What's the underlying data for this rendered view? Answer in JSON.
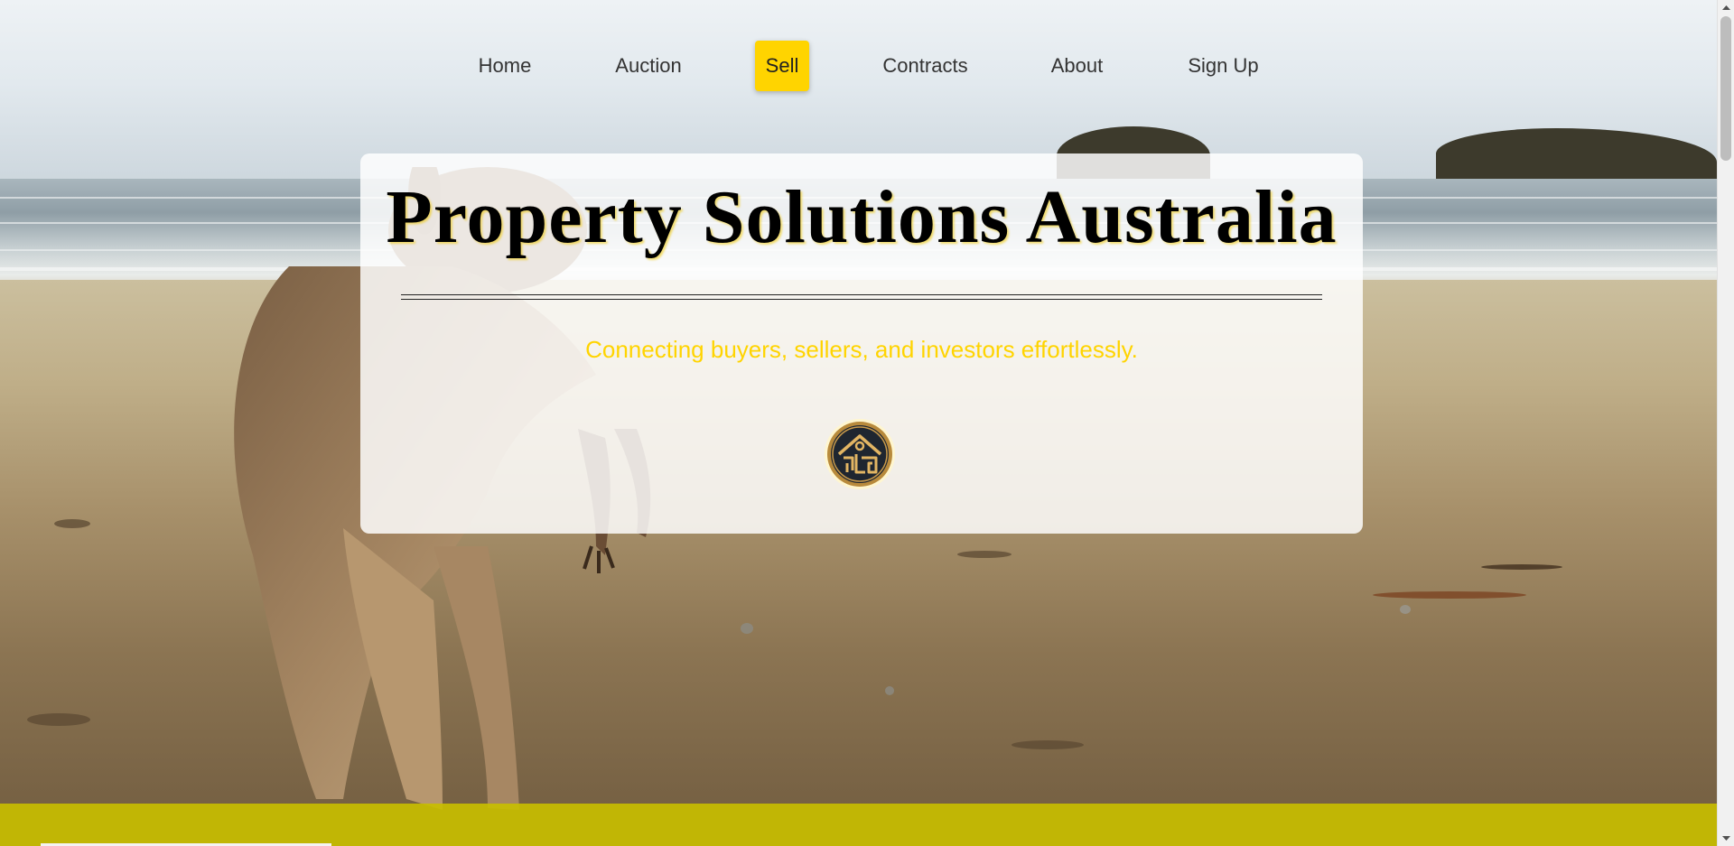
{
  "nav": {
    "items": [
      {
        "label": "Home",
        "active": false
      },
      {
        "label": "Auction",
        "active": false
      },
      {
        "label": "Sell",
        "active": true
      },
      {
        "label": "Contracts",
        "active": false
      },
      {
        "label": "About",
        "active": false
      },
      {
        "label": "Sign Up",
        "active": false
      }
    ]
  },
  "hero": {
    "title": "Property Solutions Australia",
    "subtitle": "Connecting buyers, sellers, and investors effortlessly.",
    "logo_icon": "house-emblem-icon"
  },
  "colors": {
    "accent": "#ffd400",
    "footer_band": "#c8be00",
    "title_text": "#000000"
  },
  "background": {
    "subject": "kangaroo-on-beach-icon"
  }
}
